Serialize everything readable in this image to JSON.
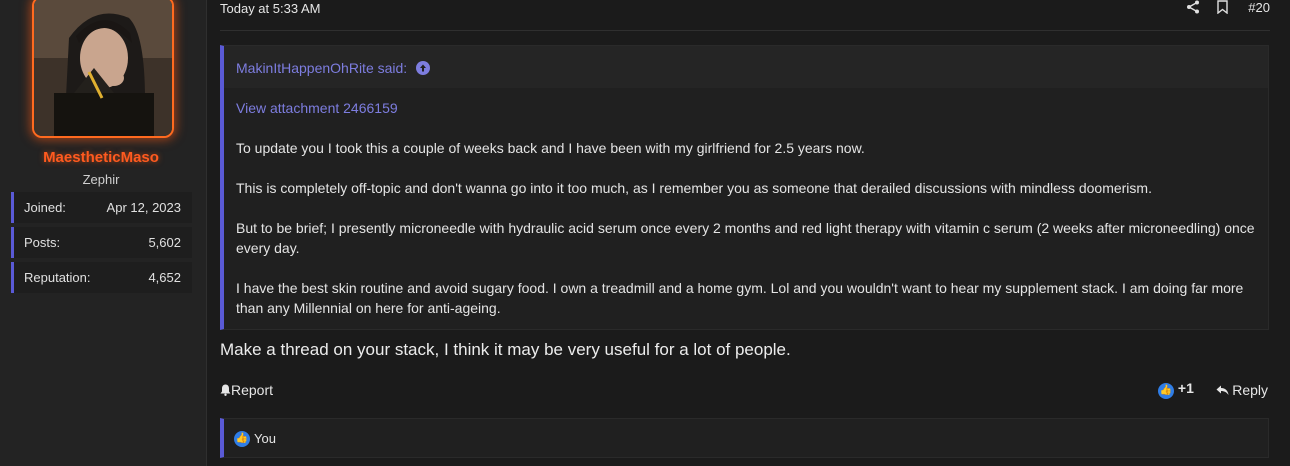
{
  "user": {
    "username": "MaestheticMaso",
    "title": "Zephir",
    "stats": [
      {
        "label": "Joined:",
        "value": "Apr 12, 2023"
      },
      {
        "label": "Posts:",
        "value": "5,602"
      },
      {
        "label": "Reputation:",
        "value": "4,652"
      }
    ]
  },
  "post": {
    "timestamp": "Today at 5:33 AM",
    "number": "#20",
    "quote": {
      "author": "MakinItHappenOhRite said:",
      "attachment": "View attachment 2466159",
      "paragraphs": [
        "To update you I took this a couple of weeks back and I have been with my girlfriend for 2.5 years now.",
        "This is completely off-topic and don't wanna go into it too much, as I remember you as someone that derailed discussions with mindless doomerism.",
        "But to be brief; I presently microneedle with hydraulic acid serum once every 2 months and red light therapy with vitamin c serum (2 weeks after microneedling) once every day.",
        "I have the best skin routine and avoid sugary food. I own a treadmill and a home gym. Lol and you wouldn't want to hear my supplement stack. I am doing far more than any Millennial on here for anti-ageing."
      ]
    },
    "body": "Make a thread on your stack, I think it may be very useful for a lot of people.",
    "actions": {
      "report": "Report",
      "reaction_count": "+1",
      "reply": "Reply"
    },
    "likes_by": "You"
  },
  "colors": {
    "accent": "#5a5ad6",
    "link": "#7d7ddf",
    "username": "#ff5a1f"
  }
}
